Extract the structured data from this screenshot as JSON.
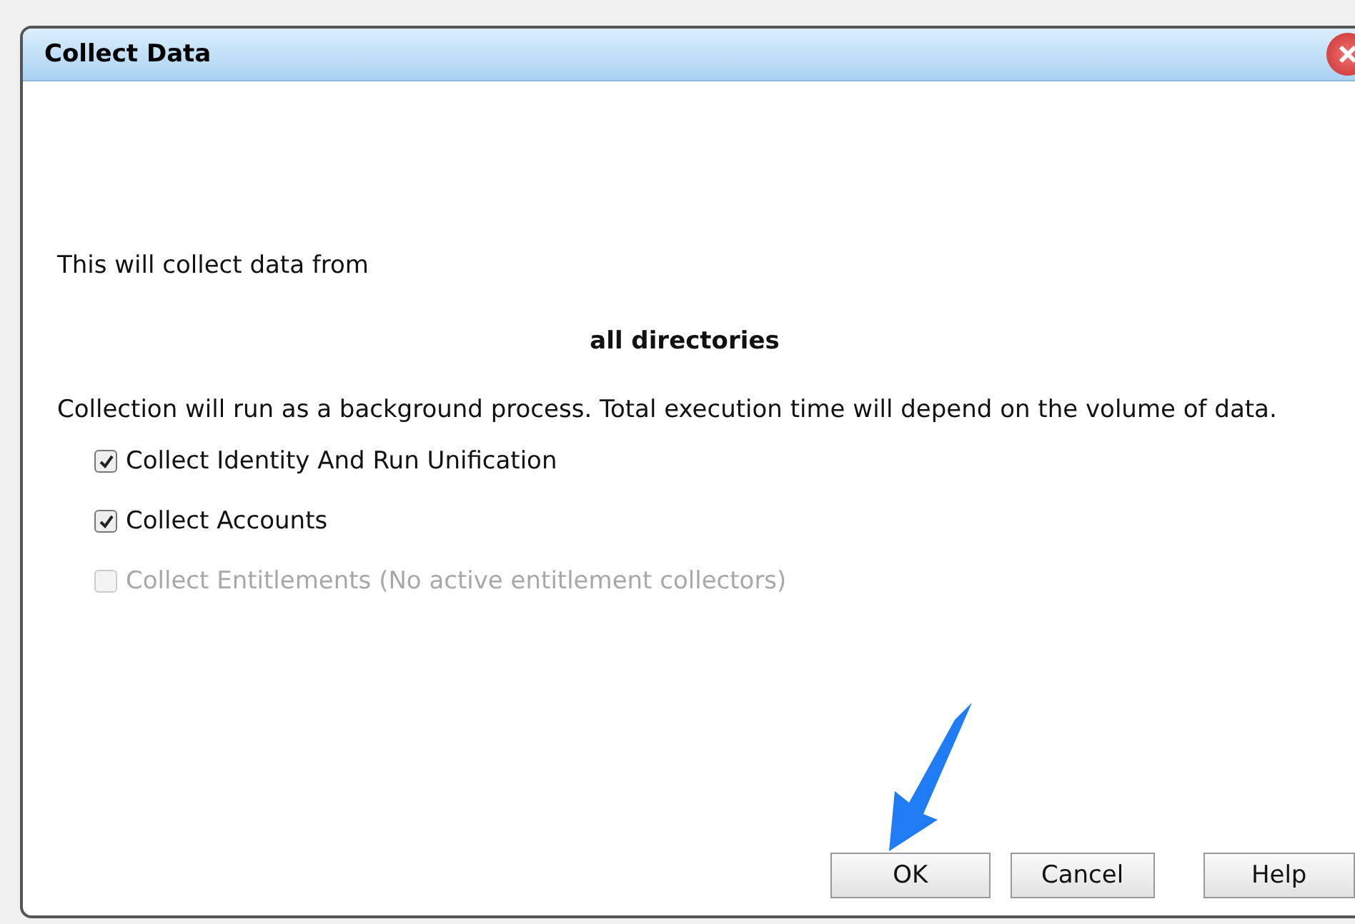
{
  "window": {
    "title": "Collect Data"
  },
  "intro": "This will collect data from",
  "scope": "all directories",
  "note": "Collection will run as a background process. Total execution time will depend on the volume of data.",
  "options": [
    {
      "label": "Collect Identity And Run Unification",
      "checked": true,
      "disabled": false
    },
    {
      "label": "Collect Accounts",
      "checked": true,
      "disabled": false
    },
    {
      "label": "Collect Entitlements (No active entitlement collectors)",
      "checked": false,
      "disabled": true
    }
  ],
  "buttons": [
    {
      "label": "OK",
      "kind": "ok"
    },
    {
      "label": "Cancel",
      "kind": "cancel"
    },
    {
      "label": "Help",
      "kind": "help"
    }
  ]
}
